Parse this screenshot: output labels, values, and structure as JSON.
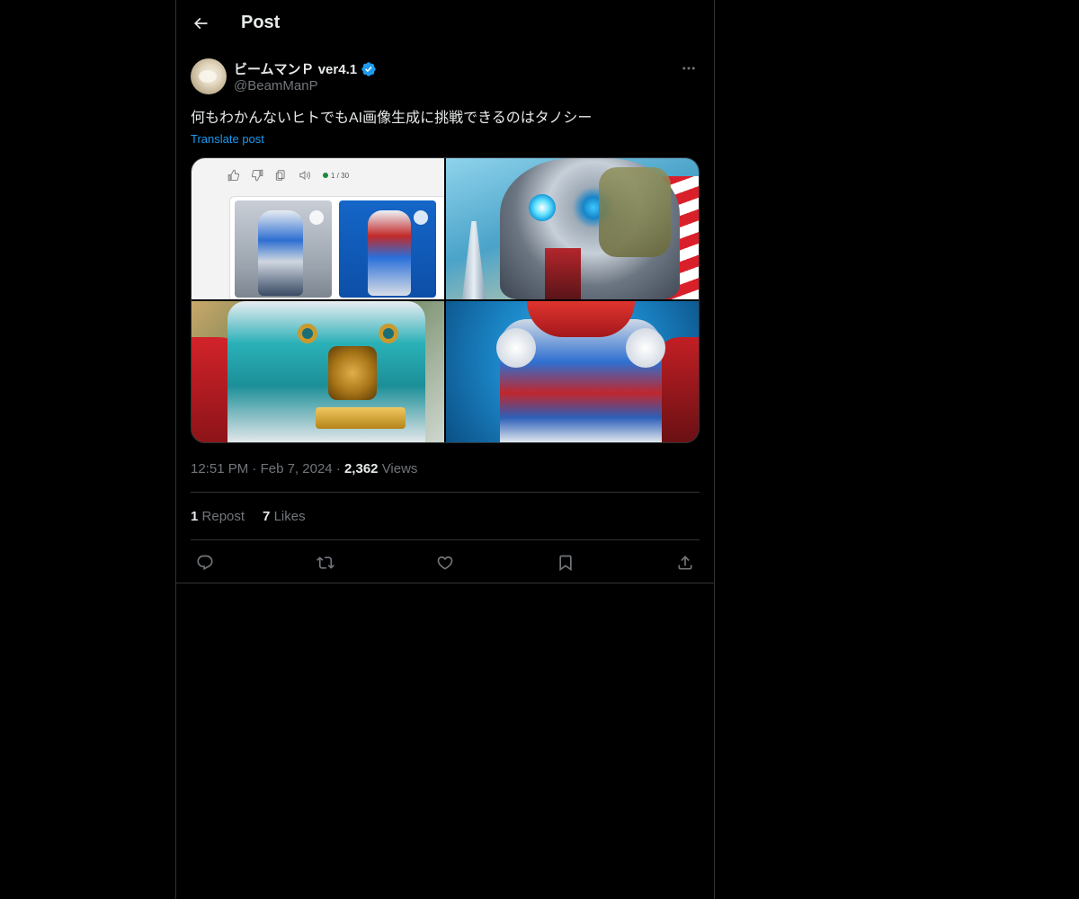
{
  "header": {
    "back_icon": "arrow-left-icon",
    "title": "Post"
  },
  "post": {
    "author": {
      "display_name": "ビームマンＰ ver4.1",
      "handle": "@BeamManP",
      "verified": true,
      "verified_color": "#1d9bf0"
    },
    "more_icon": "more-horizontal-icon",
    "text": "何もわかんないヒトでもAI画像生成に挑戦できるのはタノシー",
    "translate_label": "Translate post",
    "media": {
      "image_count": 4,
      "image_1_counter": "1 / 30"
    },
    "time": "12:51 PM",
    "separator": "·",
    "date": "Feb 7, 2024",
    "views_count": "2,362",
    "views_label": "Views",
    "stats": {
      "reposts_count": "1",
      "reposts_label": "Repost",
      "likes_count": "7",
      "likes_label": "Likes"
    },
    "actions": [
      {
        "name": "reply",
        "icon": "reply-icon"
      },
      {
        "name": "repost",
        "icon": "repost-icon"
      },
      {
        "name": "like",
        "icon": "heart-icon"
      },
      {
        "name": "bookmark",
        "icon": "bookmark-icon"
      },
      {
        "name": "share",
        "icon": "share-icon"
      }
    ]
  },
  "colors": {
    "background": "#000000",
    "text_primary": "#e7e9ea",
    "text_secondary": "#71767b",
    "accent": "#1d9bf0",
    "border": "#2f3336"
  }
}
